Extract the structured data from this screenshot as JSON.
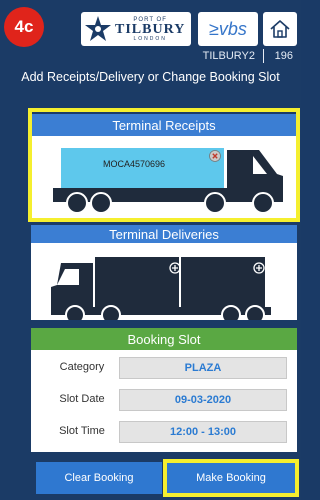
{
  "step_badge": "4c",
  "header": {
    "logo_port": "PORT OF",
    "logo_name": "TILBURY",
    "logo_city": "LONDON",
    "vbs_logo": "≥vbs",
    "home_icon": "home-icon"
  },
  "info_bar": {
    "user": "TILBURY2",
    "number": "196"
  },
  "page_title": "Add Receipts/Delivery or Change Booking Slot",
  "receipts": {
    "title": "Terminal Receipts",
    "container_id": "MOCA4570696",
    "remove_icon": "close-circle-icon"
  },
  "deliveries": {
    "title": "Terminal Deliveries",
    "add_icon": "plus-circle-icon"
  },
  "booking_slot": {
    "title": "Booking Slot",
    "category_label": "Category",
    "category_value": "PLAZA",
    "date_label": "Slot Date",
    "date_value": "09-03-2020",
    "time_label": "Slot Time",
    "time_value": "12:00 - 13:00"
  },
  "buttons": {
    "clear": "Clear Booking",
    "make": "Make Booking"
  },
  "colors": {
    "background": "#1b3b66",
    "panel_header_blue": "#3b7ed3",
    "panel_header_green": "#5aa843",
    "highlight": "#f5ef2f",
    "badge": "#e0241b",
    "truck_dark": "#1f2b3c",
    "container_cyan": "#5ec8ec"
  }
}
